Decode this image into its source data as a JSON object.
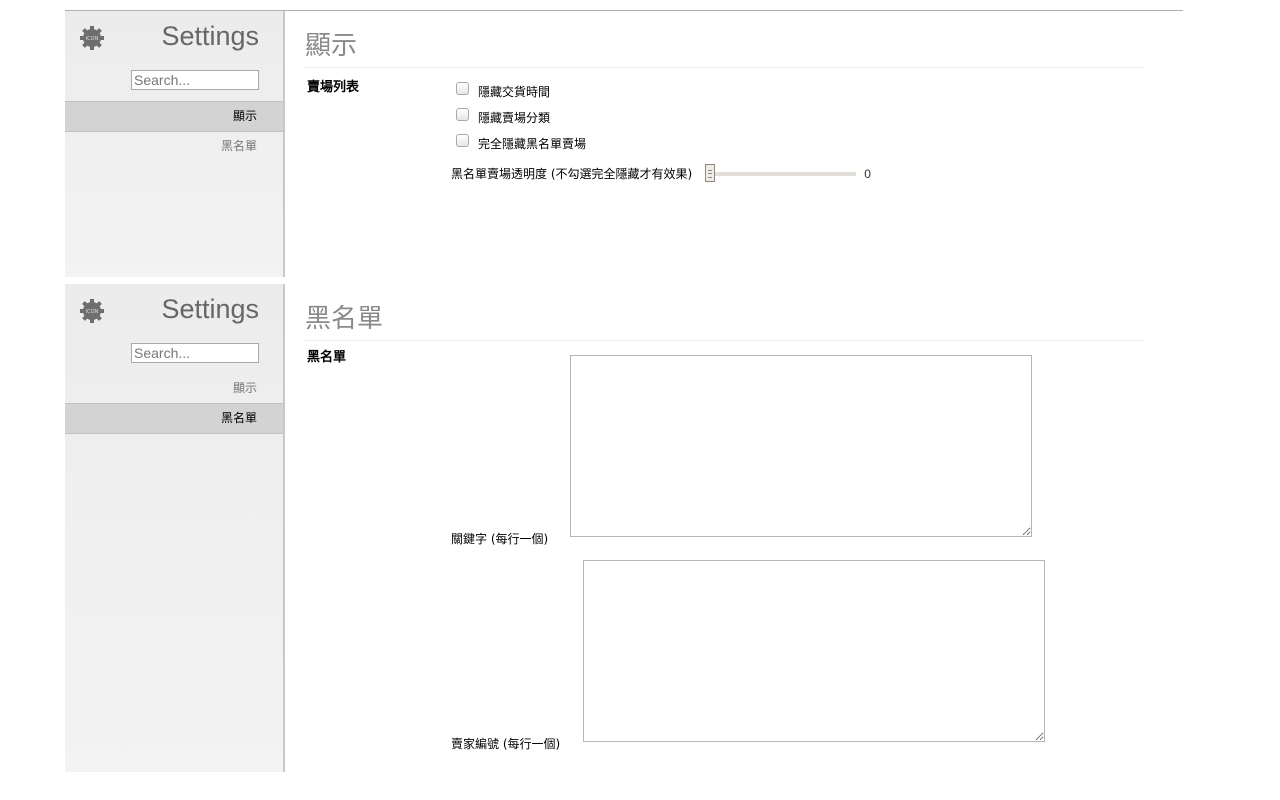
{
  "panels": [
    {
      "sidebar": {
        "title": "Settings",
        "icon": "gear-icon",
        "search_placeholder": "Search...",
        "nav": [
          {
            "label": "顯示",
            "active": true
          },
          {
            "label": "黑名單",
            "active": false
          }
        ]
      },
      "main": {
        "heading": "顯示",
        "section_label": "賣場列表",
        "options": [
          {
            "label": "隱藏交貨時間",
            "checked": false
          },
          {
            "label": "隱藏賣場分類",
            "checked": false
          },
          {
            "label": "完全隱藏黑名單賣場",
            "checked": false
          }
        ],
        "slider": {
          "label": "黑名單賣場透明度 (不勾選完全隱藏才有效果)",
          "value": "0",
          "fraction": 0
        }
      }
    },
    {
      "sidebar": {
        "title": "Settings",
        "icon": "gear-icon",
        "search_placeholder": "Search...",
        "nav": [
          {
            "label": "顯示",
            "active": false
          },
          {
            "label": "黑名單",
            "active": true
          }
        ]
      },
      "main": {
        "heading": "黑名單",
        "section_label": "黑名單",
        "fields": [
          {
            "label": "關鍵字 (每行一個)",
            "value": ""
          },
          {
            "label": "賣家編號 (每行一個)",
            "value": ""
          }
        ]
      }
    }
  ]
}
